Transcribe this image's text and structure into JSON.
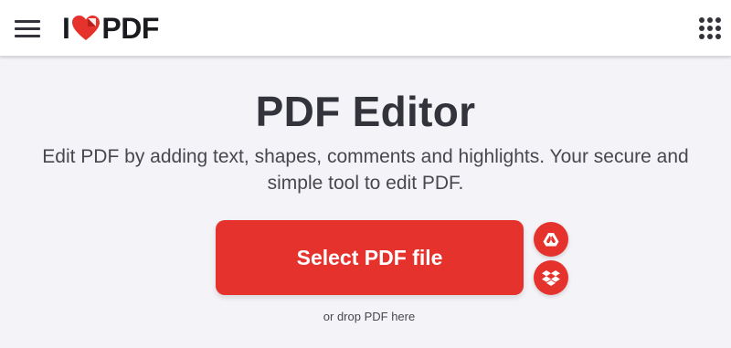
{
  "header": {
    "logo": {
      "left": "I",
      "right": "PDF",
      "icon": "heart-icon"
    },
    "menu_icon": "hamburger-menu-icon",
    "apps_icon": "apps-grid-icon"
  },
  "main": {
    "title": "PDF Editor",
    "description": "Edit PDF by adding text, shapes, comments and highlights. Your secure and simple tool to edit PDF.",
    "select_button_label": "Select PDF file",
    "drop_hint": "or drop PDF here",
    "cloud_buttons": [
      {
        "name": "google-drive",
        "icon": "google-drive-icon"
      },
      {
        "name": "dropbox",
        "icon": "dropbox-icon"
      }
    ]
  },
  "colors": {
    "brand_red": "#e5322d",
    "text_dark": "#33333b",
    "background": "#f4f3f7",
    "header_bg": "#ffffff"
  }
}
